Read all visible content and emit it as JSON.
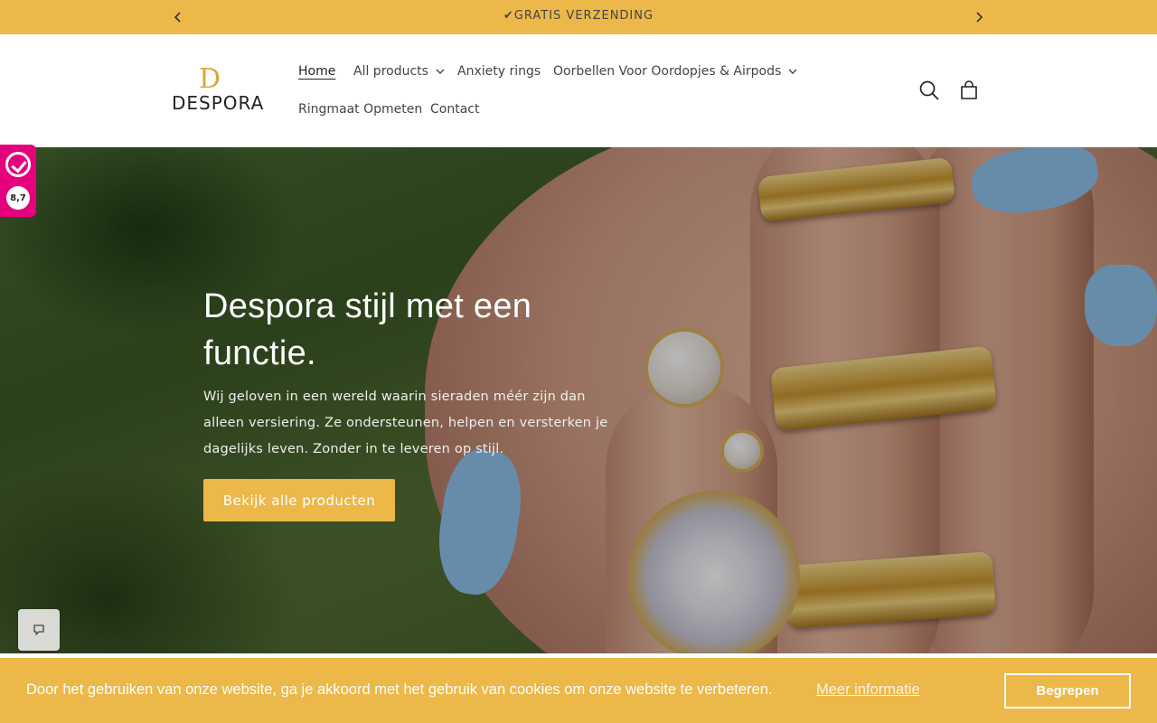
{
  "announcement": {
    "text": "✔GRATIS VERZENDING",
    "prev_icon": "chevron-left-icon",
    "next_icon": "chevron-right-icon"
  },
  "header": {
    "logo_monogram": "D",
    "logo_text": "DESPORA",
    "nav": [
      {
        "label": "Home",
        "active": true,
        "has_dropdown": false
      },
      {
        "label": "All products",
        "active": false,
        "has_dropdown": true
      },
      {
        "label": "Anxiety rings",
        "active": false,
        "has_dropdown": false
      },
      {
        "label": "Oorbellen Voor Oordopjes & Airpods",
        "active": false,
        "has_dropdown": true
      },
      {
        "label": "Ringmaat Opmeten",
        "active": false,
        "has_dropdown": false
      },
      {
        "label": "Contact",
        "active": false,
        "has_dropdown": false
      }
    ],
    "icons": [
      "search-icon",
      "cart-icon"
    ]
  },
  "hero": {
    "heading": "Despora stijl met een functie.",
    "text": "Wij geloven in een wereld waarin sieraden méér zijn dan alleen versiering. Ze ondersteunen, helpen en versterken je dagelijks leven. Zonder in te leveren op stijl.",
    "button_label": "Bekijk alle producten"
  },
  "kiyoh_badge": {
    "score": "8,7"
  },
  "cookie_bar": {
    "message": "Door het gebruiken van onze website, ga je akkoord met het gebruik van cookies om onze website te verbeteren.",
    "more_link": "Meer informatie",
    "accept_label": "Begrepen"
  },
  "colors": {
    "accent": "#ecb84a",
    "kiyoh": "#e6007e",
    "text": "#444444"
  }
}
